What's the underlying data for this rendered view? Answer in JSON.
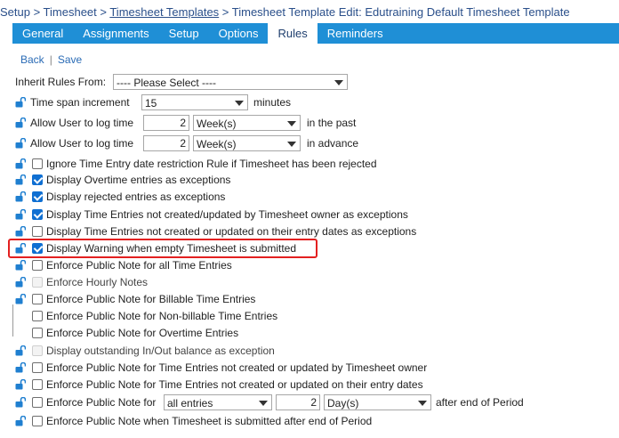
{
  "breadcrumb": {
    "part1": "Setup > Timesheet > ",
    "part2": "Timesheet Templates",
    "part3": " > Timesheet Template Edit: Edutraining Default Timesheet Template"
  },
  "tabs": [
    {
      "label": "General",
      "active": false
    },
    {
      "label": "Assignments",
      "active": false
    },
    {
      "label": "Setup",
      "active": false
    },
    {
      "label": "Options",
      "active": false
    },
    {
      "label": "Rules",
      "active": true
    },
    {
      "label": "Reminders",
      "active": false
    }
  ],
  "actions": {
    "back": "Back",
    "separator": "|",
    "save": "Save"
  },
  "inherit": {
    "label": "Inherit Rules From:",
    "value": "---- Please Select ----"
  },
  "time_span": {
    "label": "Time span increment",
    "value": "15",
    "unit": "minutes"
  },
  "past": {
    "label": "Allow User to log time",
    "number": "2",
    "period": "Week(s)",
    "suffix": "in the past"
  },
  "advance": {
    "label": "Allow User to log time",
    "number": "2",
    "period": "Week(s)",
    "suffix": "in advance"
  },
  "rules": [
    {
      "label": "Ignore Time Entry date restriction Rule if Timesheet has been rejected",
      "checked": false,
      "disabled": false
    },
    {
      "label": "Display Overtime entries as exceptions",
      "checked": true,
      "disabled": false
    },
    {
      "label": "Display rejected entries as exceptions",
      "checked": true,
      "disabled": false
    },
    {
      "label": "Display Time Entries not created/updated by Timesheet owner as exceptions",
      "checked": true,
      "disabled": false
    },
    {
      "label": "Display Time Entries not created or updated on their entry dates as exceptions",
      "checked": false,
      "disabled": false
    },
    {
      "label": "Display Warning when empty Timesheet is submitted",
      "checked": true,
      "disabled": false
    },
    {
      "label": "Enforce Public Note for all Time Entries",
      "checked": false,
      "disabled": false
    },
    {
      "label": "Enforce Hourly Notes",
      "checked": false,
      "disabled": true
    },
    {
      "label": "Enforce Public Note for Billable Time Entries",
      "checked": false,
      "disabled": false
    },
    {
      "label": "Enforce Public Note for Non-billable Time Entries",
      "checked": false,
      "disabled": false
    },
    {
      "label": "Enforce Public Note for Overtime Entries",
      "checked": false,
      "disabled": false
    },
    {
      "label": "Display outstanding In/Out balance as exception",
      "checked": false,
      "disabled": true
    },
    {
      "label": "Enforce Public Note for Time Entries not created or updated by Timesheet owner",
      "checked": false,
      "disabled": false
    },
    {
      "label": "Enforce Public Note for Time Entries not created or updated on their entry dates",
      "checked": false,
      "disabled": false
    }
  ],
  "period_rule": {
    "label": "Enforce Public Note for",
    "entries": "all entries",
    "number": "2",
    "period": "Day(s)",
    "suffix": "after end of Period"
  },
  "last_rule": {
    "label": "Enforce Public Note when Timesheet is submitted after end of Period"
  }
}
